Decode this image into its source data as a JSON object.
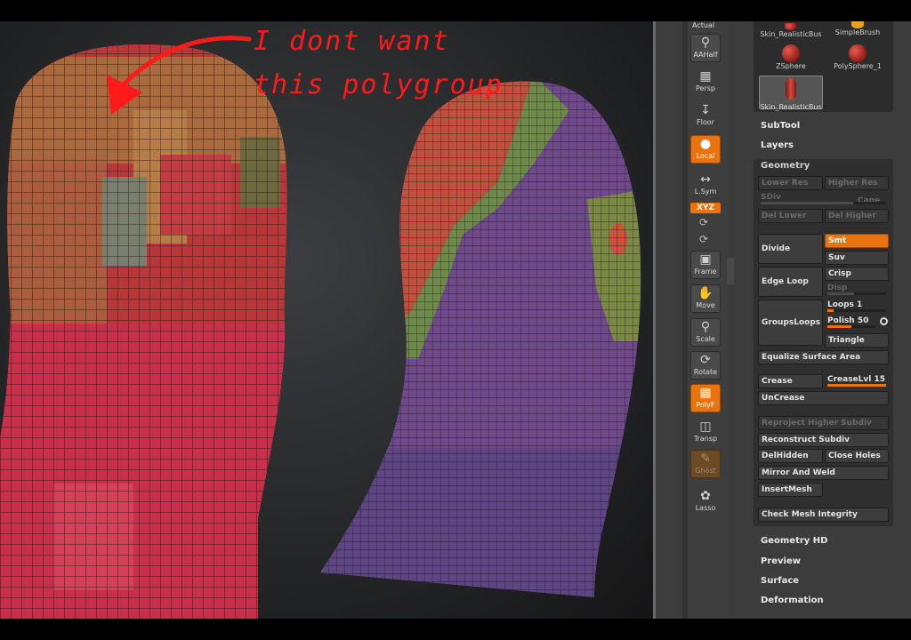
{
  "annotation": {
    "line1": "I dont want",
    "line2": "this polygroup"
  },
  "shelf": {
    "top_label": "Actual",
    "tools": [
      {
        "label": "AAHalf",
        "icon": "magnifier-icon"
      },
      {
        "label": "Persp",
        "icon": "perspective-grid-icon"
      },
      {
        "label": "Floor",
        "icon": "floor-icon"
      },
      {
        "label": "Local",
        "icon": "local-pivot-icon"
      },
      {
        "label": "L.Sym",
        "icon": "local-symmetry-icon"
      },
      {
        "label": "XYZ",
        "icon": "xyz-rotate-icon"
      },
      {
        "label": "Frame",
        "icon": "frame-icon"
      },
      {
        "label": "Move",
        "icon": "hand-move-icon"
      },
      {
        "label": "Scale",
        "icon": "scale-icon"
      },
      {
        "label": "Rotate",
        "icon": "rotate-icon"
      },
      {
        "label": "PolyF",
        "icon": "polyframe-icon"
      },
      {
        "label": "Transp",
        "icon": "transparency-icon"
      },
      {
        "label": "Ghost",
        "icon": "ghost-icon"
      },
      {
        "label": "Lasso",
        "icon": "lasso-icon"
      }
    ]
  },
  "brushes": {
    "items": [
      {
        "label": "Skin_RealisticBus"
      },
      {
        "label": "SimpleBrush"
      },
      {
        "label": "ZSphere"
      },
      {
        "label": "PolySphere_1"
      },
      {
        "label": "Skin_RealisticBus"
      }
    ]
  },
  "menus": {
    "subtool": "SubTool",
    "layers": "Layers",
    "geometry_hd": "Geometry HD",
    "preview": "Preview",
    "surface": "Surface",
    "deformation": "Deformation"
  },
  "geometry": {
    "title": "Geometry",
    "lower_res": "Lower Res",
    "higher_res": "Higher Res",
    "sdiv": "SDiv",
    "cage": "Cage",
    "del_lower": "Del Lower",
    "del_higher": "Del Higher",
    "divide": "Divide",
    "smt": "Smt",
    "suv": "Suv",
    "edge_loop": "Edge Loop",
    "crisp": "Crisp",
    "disp": "Disp",
    "groups_loops": "GroupsLoops",
    "loops": "Loops 1",
    "loops_value": 0.1,
    "polish": "Polish 50",
    "polish_value": 0.5,
    "triangle": "Triangle",
    "equalize": "Equalize Surface Area",
    "crease": "Crease",
    "crease_lvl": "CreaseLvl 15",
    "crease_lvl_value": 1.0,
    "uncrease": "UnCrease",
    "reproject": "Reproject Higher Subdiv",
    "reconstruct": "Reconstruct Subdiv",
    "del_hidden": "DelHidden",
    "close_holes": "Close Holes",
    "mirror_weld": "Mirror And Weld",
    "insert_mesh": "InsertMesh",
    "check_mesh": "Check Mesh Integrity"
  },
  "colors": {
    "accent": "#e8730f",
    "polygroup_red": "#c8303c",
    "polygroup_tan": "#a8703e",
    "polygroup_green": "#6e8a4a",
    "polygroup_purple": "#6e4a8a",
    "annotation_red": "#ff1a1a"
  }
}
